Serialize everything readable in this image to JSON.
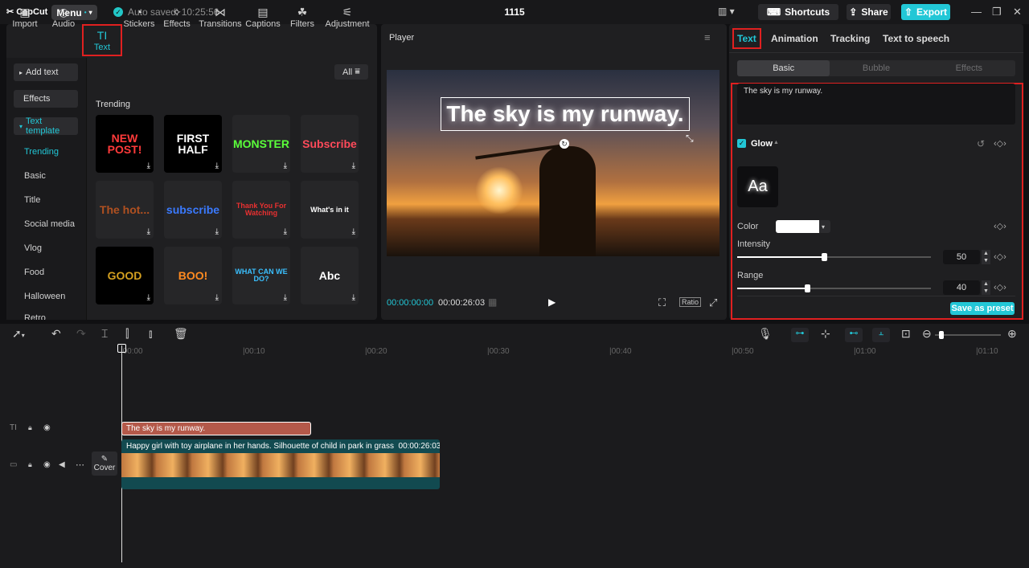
{
  "titlebar": {
    "app_name": "CapCut",
    "menu_label": "Menu",
    "autosave": "Auto saved: 10:25:56",
    "project_title": "1115",
    "shortcuts_label": "Shortcuts",
    "share_label": "Share",
    "export_label": "Export"
  },
  "left_panel": {
    "tabs": [
      {
        "label": "Import",
        "icon": "▣"
      },
      {
        "label": "Audio",
        "icon": "◷"
      },
      {
        "label": "Text",
        "icon": "TI"
      },
      {
        "label": "Stickers",
        "icon": "◔"
      },
      {
        "label": "Effects",
        "icon": "✧"
      },
      {
        "label": "Transitions",
        "icon": "⋈"
      },
      {
        "label": "Captions",
        "icon": "▤"
      },
      {
        "label": "Filters",
        "icon": "☘"
      },
      {
        "label": "Adjustment",
        "icon": "⚟"
      }
    ],
    "sidebar": {
      "add_text": "Add text",
      "effects": "Effects",
      "text_template": "Text template",
      "subitems": [
        "Trending",
        "Basic",
        "Title",
        "Social media",
        "Vlog",
        "Food",
        "Halloween",
        "Retro"
      ]
    },
    "filter_label": "All",
    "section_title": "Trending",
    "templates": [
      {
        "text": "NEW POST!",
        "color": "#ff3a3a"
      },
      {
        "text": "FIRST HALF",
        "color": "#ffffff"
      },
      {
        "text": "MONSTER",
        "color": "#5aff3a"
      },
      {
        "text": "Subscribe",
        "color": "#ff4a5a"
      },
      {
        "text": "The hot...",
        "color": "#b05020"
      },
      {
        "text": "subscribe",
        "color": "#3a7aff"
      },
      {
        "text": "Thank You For Watching",
        "color": "#e83030"
      },
      {
        "text": "What's in it",
        "color": "#ffffff"
      },
      {
        "text": "GOOD",
        "color": "#d4a020"
      },
      {
        "text": "BOO!",
        "color": "#ff8a20"
      },
      {
        "text": "WHAT CAN WE DO?",
        "color": "#3ac0ff"
      },
      {
        "text": "Abc",
        "color": "#ffffff"
      }
    ]
  },
  "player": {
    "title": "Player",
    "overlay_text": "The sky is my runway.",
    "current_time": "00:00:00:00",
    "duration": "00:00:26:03",
    "ratio_label": "Ratio"
  },
  "right_panel": {
    "tabs": [
      "Text",
      "Animation",
      "Tracking",
      "Text to speech"
    ],
    "subtabs": [
      "Basic",
      "Bubble",
      "Effects"
    ],
    "text_value": "The sky is my runway.",
    "glow_label": "Glow",
    "glow_enabled": true,
    "preview_label": "Aa",
    "color_label": "Color",
    "color_value": "#ffffff",
    "intensity_label": "Intensity",
    "intensity_value": "50",
    "intensity_fraction": 0.5,
    "range_label": "Range",
    "range_value": "40",
    "range_fraction": 0.4,
    "save_preset_label": "Save as preset"
  },
  "timeline": {
    "ruler": [
      "00:00",
      "00:10",
      "00:20",
      "00:30",
      "00:40",
      "00:50",
      "01:00",
      "01:10"
    ],
    "text_clip": "The sky is my runway.",
    "video_clip_title": "Happy girl with toy airplane in her hands. Silhouette of child in park in grass",
    "video_clip_duration": "00:00:26:03",
    "cover_label": "Cover"
  }
}
